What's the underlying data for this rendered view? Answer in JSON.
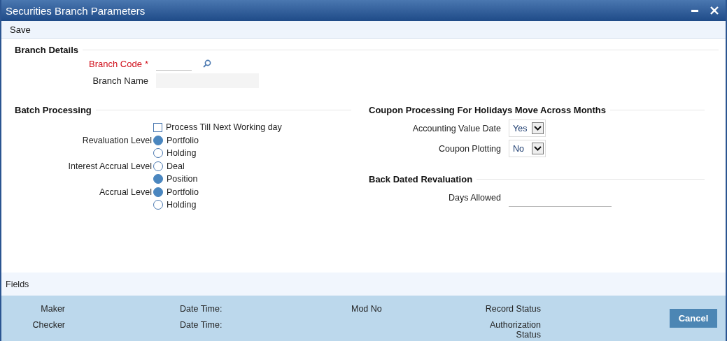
{
  "window": {
    "title": "Securities Branch Parameters"
  },
  "toolbar": {
    "buttons": [
      "Save"
    ]
  },
  "branch_details": {
    "heading": "Branch Details",
    "fields": [
      {
        "label": "Branch Code",
        "required": true,
        "marker": "*",
        "kind": "lookup"
      },
      {
        "label": "Branch Name",
        "required": false,
        "kind": "text"
      }
    ]
  },
  "batch_processing": {
    "heading": "Batch Processing",
    "rows": [
      {
        "kind": "checkbox",
        "label": "Process Till Next Working day",
        "checked": false
      },
      {
        "kind": "radio",
        "label": "Revaluation Level",
        "options": [
          {
            "label": "Portfolio",
            "selected": true
          },
          {
            "label": "Holding",
            "selected": false
          }
        ]
      },
      {
        "kind": "radio",
        "label": "Interest Accrual Level",
        "options": [
          {
            "label": "Deal",
            "selected": false
          },
          {
            "label": "Position",
            "selected": true
          }
        ]
      },
      {
        "kind": "radio",
        "label": "Accrual Level",
        "options": [
          {
            "label": "Portfolio",
            "selected": true
          },
          {
            "label": "Holding",
            "selected": false
          }
        ]
      }
    ]
  },
  "coupon_processing": {
    "heading": "Coupon Processing For Holidays Move Across Months",
    "fields": [
      {
        "label": "Accounting Value Date",
        "value": "Yes"
      },
      {
        "label": "Coupon Plotting",
        "value": "No"
      }
    ]
  },
  "back_dated_revaluation": {
    "heading": "Back Dated Revaluation",
    "fields": [
      {
        "label": "Days Allowed"
      }
    ]
  },
  "fields_bar": {
    "label": "Fields"
  },
  "audit": {
    "columns": [
      {
        "items": [
          "Maker",
          "Checker"
        ]
      },
      {
        "items": [
          "Date Time:",
          "Date Time:"
        ]
      },
      {
        "items": [
          "Mod No"
        ]
      },
      {
        "items": [
          "Record Status",
          "Authorization Status"
        ]
      }
    ],
    "button": "Cancel"
  }
}
